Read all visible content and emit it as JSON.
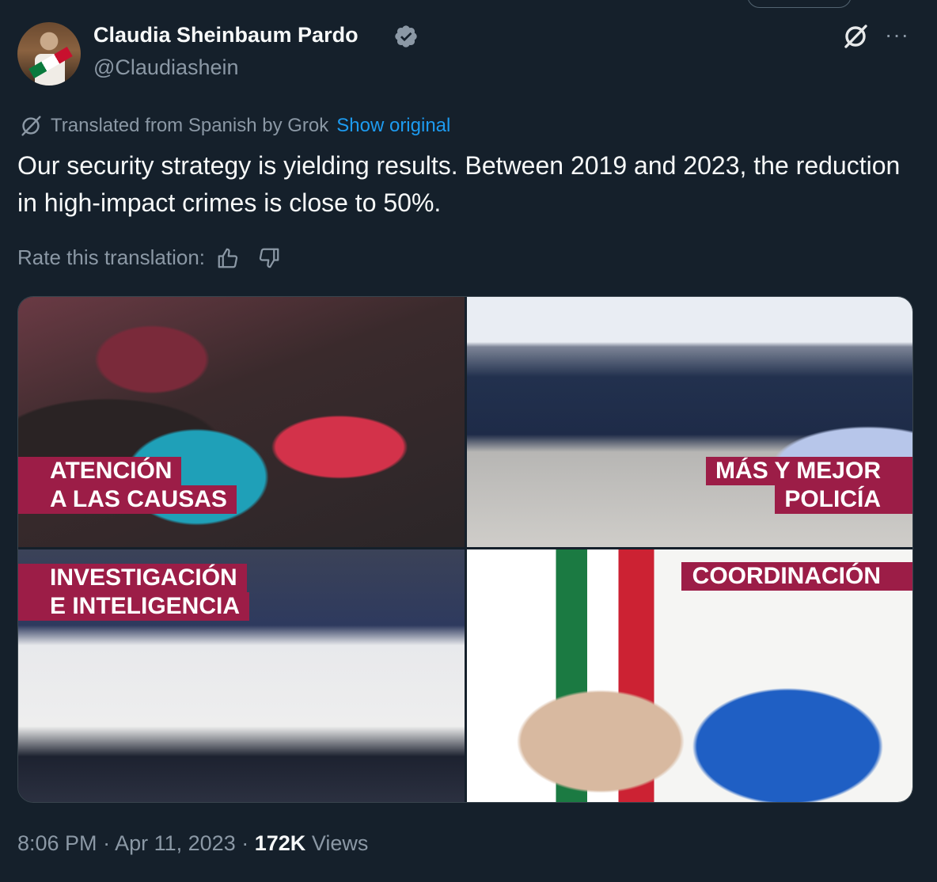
{
  "author": {
    "name": "Claudia Sheinbaum Pardo",
    "handle": "@Claudiashein"
  },
  "translation": {
    "note": "Translated from Spanish by Grok",
    "show_original": "Show original",
    "rate_label": "Rate this translation:"
  },
  "tweet": {
    "text": "Our security strategy is yielding results. Between 2019 and 2023, the reduction in high-impact crimes is close to 50%."
  },
  "media": {
    "tile1": {
      "line1": "ATENCIÓN",
      "line2": "A LAS CAUSAS"
    },
    "tile2": {
      "line1": "MÁS Y MEJOR",
      "line2": "POLICÍA"
    },
    "tile3": {
      "line1": "INVESTIGACIÓN",
      "line2": "E INTELIGENCIA"
    },
    "tile4": {
      "line1": "COORDINACIÓN"
    }
  },
  "meta": {
    "time": "8:06 PM",
    "sep1": "·",
    "date": "Apr 11, 2023",
    "sep2": "·",
    "views_count": "172K",
    "views_label": "Views"
  },
  "icons": {
    "verified": "verified-badge-icon",
    "grok": "grok-icon",
    "more": "more-icon",
    "thumbs_up": "thumbs-up-icon",
    "thumbs_down": "thumbs-down-icon"
  },
  "colors": {
    "background": "#15202b",
    "link": "#1d9bf0",
    "label_bg": "#9c1d47"
  }
}
